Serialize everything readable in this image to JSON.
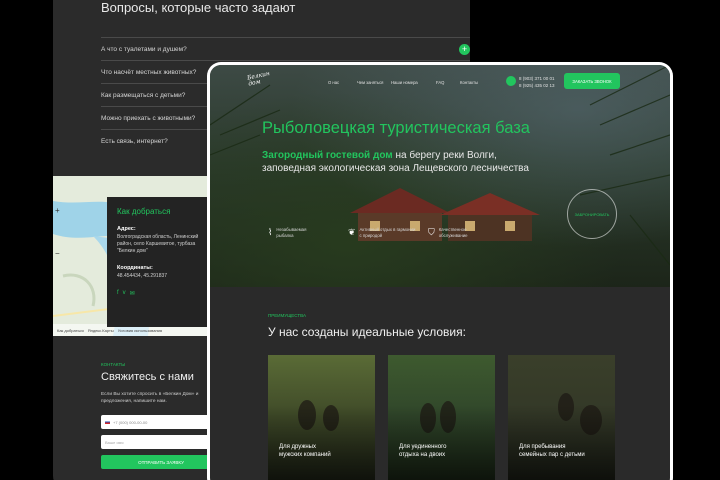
{
  "faq": {
    "title": "Вопросы, которые часто задают",
    "items": [
      {
        "q": "А что с туалетами и душем?"
      },
      {
        "q": "Что насчёт местных животных?"
      },
      {
        "q": "Как размещаться с детьми?"
      },
      {
        "q": "Можно приехать с животными?"
      },
      {
        "q": "Есть связь, интернет?"
      }
    ],
    "expand_symbol": "+"
  },
  "map": {
    "zoom_in": "+",
    "zoom_out": "−",
    "footer_1": "Как добраться",
    "footer_2": "Яндекс.Карты",
    "footer_3": "Условия использования"
  },
  "route": {
    "title": "Как добраться",
    "address_label": "Адрес:",
    "address": "Волгоградская область, Ленинский район, село Каршевитое, турбаза \"Белкин дом\"",
    "coords_label": "Координаты:",
    "coords": "48.454434, 45.291837",
    "socials": [
      "f",
      "v",
      "✉"
    ]
  },
  "contacts": {
    "tag": "КОНТАКТЫ",
    "title": "Свяжитесь с нами",
    "text": "Если Вы хотите спросить в «Белкин Дом» и предложения, напишите нам.",
    "phone_placeholder": "+7 (000) 000-00-00",
    "name_placeholder": "Ваше имя",
    "send": "ОТПРАВИТЬ ЗАЯВКУ"
  },
  "nav": {
    "logo": "Белкин дом",
    "menu": [
      "О нас",
      "Чем заняться",
      "Наши номера",
      "FAQ",
      "Контакты"
    ],
    "phones": [
      "8 (903) 371 00 01",
      "8 (925) 435 02 13"
    ],
    "book": "ЗАКАЗАТЬ ЗВОНОК"
  },
  "hero": {
    "title": "Рыболовецкая туристическая база",
    "subtitle_highlight": "Загородный гостевой дом",
    "subtitle_rest": " на берегу реки Волги, заповедная экологическая зона Лещевского лесничества",
    "features": [
      {
        "icon": "fish-icon",
        "glyph": "⌇",
        "text": "Незабываемая рыбалка"
      },
      {
        "icon": "leaf-icon",
        "glyph": "❦",
        "text": "Активный отдых в гармонии с природой"
      },
      {
        "icon": "shield-icon",
        "glyph": "⛉",
        "text": "Качественное обслуживание"
      }
    ],
    "badge": "ЗАБРОНИРОВАТЬ"
  },
  "advantages": {
    "tag": "ПРЕИМУЩЕСТВА",
    "title": "У нас созданы идеальные условия:",
    "cards": [
      {
        "line1": "Для дружных",
        "line2": "мужских компаний"
      },
      {
        "line1": "Для уединенного",
        "line2": "отдыха на двоих"
      },
      {
        "line1": "Для пребывания",
        "line2": "семейных пар с детьми"
      }
    ]
  },
  "colors": {
    "accent": "#22c55e",
    "dark": "#2b2b2b"
  }
}
